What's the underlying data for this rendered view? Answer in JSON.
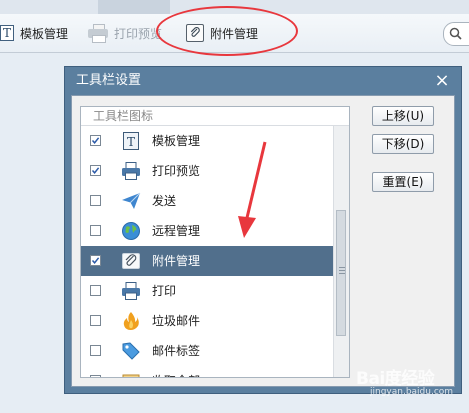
{
  "toolbar": {
    "template_label": "模板管理",
    "print_preview_label": "打印预览",
    "attachment_label": "附件管理"
  },
  "dialog": {
    "title": "工具栏设置",
    "close_glyph": "×",
    "list_header": "工具栏图标",
    "buttons": {
      "move_up": "上移(U)",
      "move_down": "下移(D)",
      "reset": "重置(E)"
    },
    "items": [
      {
        "label": "模板管理",
        "checked": true,
        "icon": "template-icon"
      },
      {
        "label": "打印预览",
        "checked": true,
        "icon": "printer-icon"
      },
      {
        "label": "发送",
        "checked": false,
        "icon": "paper-plane-icon"
      },
      {
        "label": "远程管理",
        "checked": false,
        "icon": "globe-icon"
      },
      {
        "label": "附件管理",
        "checked": true,
        "icon": "paperclip-icon",
        "selected": true
      },
      {
        "label": "打印",
        "checked": false,
        "icon": "printer-icon"
      },
      {
        "label": "垃圾邮件",
        "checked": false,
        "icon": "flame-icon"
      },
      {
        "label": "邮件标签",
        "checked": false,
        "icon": "tag-icon"
      },
      {
        "label": "收取全部",
        "checked": false,
        "icon": "inbox-icon"
      }
    ]
  },
  "watermark": {
    "brand": "Bai度经验",
    "domain": "jingyan.baidu.com"
  },
  "colors": {
    "dialog_frame": "#5b7f9f",
    "selected_row": "#516f8c",
    "annotation_red": "#e8373d"
  }
}
